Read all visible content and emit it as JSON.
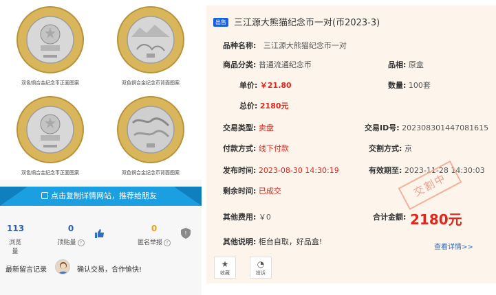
{
  "coins": {
    "captions": [
      "双色铜合金纪念币正面图案",
      "双色铜合金纪念币背面图案",
      "双色铜合金纪念币正面图案",
      "双色铜合金纪念币背面图案"
    ]
  },
  "share": {
    "label": "点击复制详情网站，推荐给朋友"
  },
  "stats": {
    "views": "113",
    "views_label": "浏览量",
    "tops": "0",
    "tops_label": "顶贴量",
    "guarantee": "0",
    "guarantee_label": "匿名举报"
  },
  "comment": {
    "label": "最新留言记录",
    "text": "确认交易，合作愉快!"
  },
  "listing": {
    "tag": "出售",
    "title": "三江源大熊猫纪念币一对(币2023-3)",
    "name_k": "品种名称:",
    "name_v": "三江源大熊猫纪念币一对",
    "cat_k": "商品分类:",
    "cat_v": "普通流通纪念币",
    "cond_k": "品相:",
    "cond_v": "原盒",
    "price_k": "单价:",
    "price_v": "￥21.80",
    "qty_k": "数量:",
    "qty_v": "100套",
    "total_k": "总价:",
    "total_v": "2180元",
    "type_k": "交易类型:",
    "type_v": "卖盘",
    "id_k": "交易ID号:",
    "id_v": "202308301447081615",
    "pay_k": "付款方式:",
    "pay_v": "线下付款",
    "place_k": "交割方式:",
    "place_v": "京",
    "time_k": "发布时间:",
    "time_v": "2023-08-30 14:30:19",
    "expire_k": "有效期至:",
    "expire_v": "2023-11-28 14:30:03",
    "remain_k": "剩余时间:",
    "remain_v": "已成交",
    "fee_k": "其他费用:",
    "fee_v": "￥0",
    "sum_k": "合计金额:",
    "sum_v": "2180元",
    "note_k": "其他说明:",
    "note_v": "柜台自取，好品盒!",
    "more": "查看详情>>",
    "stamp": "交割中"
  },
  "buttons": {
    "fav": "收藏",
    "report": "投诉"
  },
  "colors": {
    "accent_blue": "#1c9fe0",
    "price_red": "#e0261a",
    "panel_bg": "#fdf5ec"
  }
}
